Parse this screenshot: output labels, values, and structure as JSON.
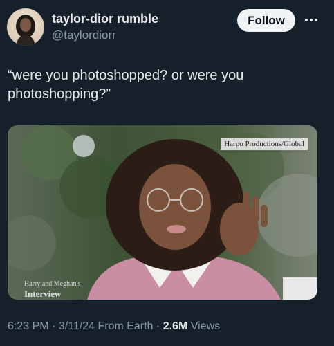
{
  "author": {
    "display_name": "taylor-dior rumble",
    "handle": "@taylordiorr",
    "avatar_icon": "profile-photo"
  },
  "actions": {
    "follow_label": "Follow",
    "more_icon": "more-horizontal-icon"
  },
  "tweet": {
    "text": "“were you photoshopped? or were you photoshopping?”"
  },
  "media": {
    "watermark": "Harpo Productions/Global",
    "caption_line1": "Harry and Meghan's",
    "caption_line2": "Interview"
  },
  "meta": {
    "time": "6:23 PM",
    "sep1": " · ",
    "date": "3/11/24",
    "source": " From Earth",
    "sep2": " · ",
    "views_count": "2.6M",
    "views_label": " Views"
  },
  "colors": {
    "background": "#15202b",
    "primary_text": "#e7e9ea",
    "secondary_text": "#8b98a5",
    "button_bg": "#eff3f4"
  }
}
